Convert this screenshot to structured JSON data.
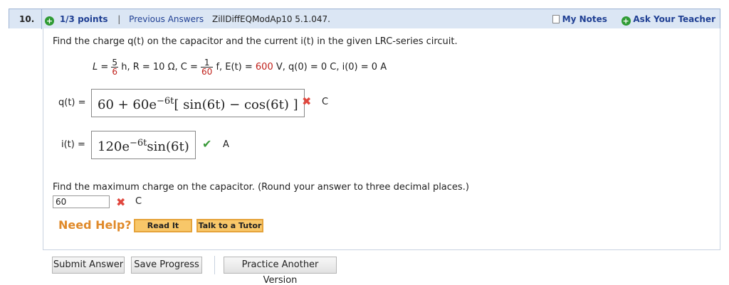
{
  "header": {
    "question_number": "10.",
    "points_label": "1/3 points",
    "separator": "|",
    "previous_answers": "Previous Answers",
    "problem_id": "ZillDiffEQModAp10 5.1.047.",
    "my_notes": "My Notes",
    "ask_teacher": "Ask Your Teacher"
  },
  "question": {
    "prompt": "Find the charge q(t) on the capacitor and the current i(t) in the given LRC-series circuit.",
    "givens": {
      "L_prefix": "L =",
      "L_num": "5",
      "L_den": "6",
      "L_unit": "h, R = 10 Ω, C =",
      "C_num": "1",
      "C_den": "60",
      "C_unit": "f, E(t) =",
      "E_value": "600",
      "tail": "V, q(0) = 0 C, i(0) = 0 A"
    }
  },
  "answers": {
    "q_label": "q(t) =",
    "q_expr_a": "60 + 60e",
    "q_expr_exp": "−6t",
    "q_expr_b": "[ sin(6t) − cos(6t) ]",
    "q_grade": "C",
    "i_label": "i(t) =",
    "i_expr_a": "120e",
    "i_expr_exp": "−6t",
    "i_expr_b": "sin(6t)",
    "i_grade": "A"
  },
  "part2": {
    "prompt": "Find the maximum charge on the capacitor. (Round your answer to three decimal places.)",
    "value": "60",
    "grade": "C"
  },
  "help": {
    "title": "Need Help?",
    "read_it": "Read It",
    "tutor": "Talk to a Tutor"
  },
  "buttons": {
    "submit": "Submit Answer",
    "save": "Save Progress",
    "practice": "Practice Another Version"
  },
  "colors": {
    "header_bg": "#dbe6f4",
    "link": "#1f3f93",
    "wrong": "#e0473e",
    "right": "#3a9a3a",
    "help": "#e08a2a"
  }
}
